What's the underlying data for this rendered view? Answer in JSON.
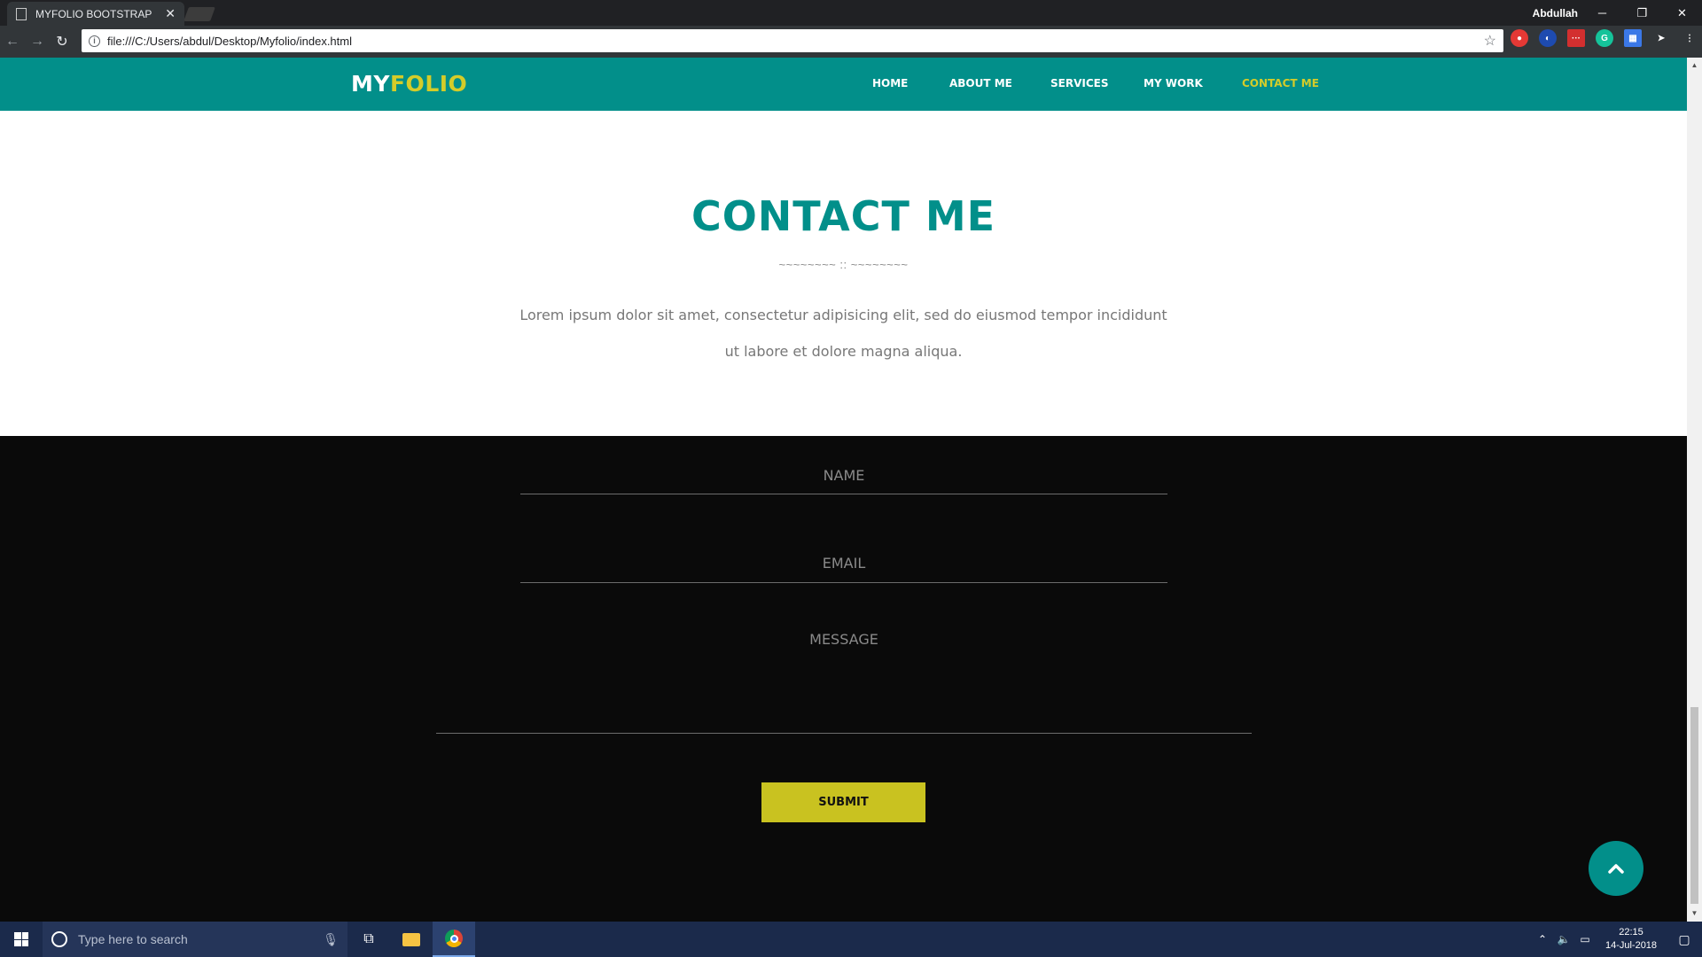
{
  "browser": {
    "tab_title": "MYFOLIO BOOTSTRAP",
    "url": "file:///C:/Users/abdul/Desktop/Myfolio/index.html",
    "user": "Abdullah"
  },
  "site": {
    "logo_part1": "MY",
    "logo_part2": "FOLIO",
    "nav": [
      {
        "label": "HOME"
      },
      {
        "label": "ABOUT ME"
      },
      {
        "label": "SERVICES"
      },
      {
        "label": "MY WORK"
      },
      {
        "label": "CONTACT ME"
      }
    ],
    "active_nav": "CONTACT ME",
    "colors": {
      "teal": "#028f8a",
      "yellow": "#d4cc29",
      "button": "#c9c220"
    }
  },
  "contact": {
    "title": "CONTACT ME",
    "divider": "~~~~~~~~ :: ~~~~~~~~",
    "lead": "Lorem ipsum dolor sit amet, consectetur adipisicing elit, sed do eiusmod tempor incididunt ut labore et dolore magna aliqua.",
    "name_placeholder": "NAME",
    "email_placeholder": "EMAIL",
    "message_placeholder": "MESSAGE",
    "submit_label": "SUBMIT"
  },
  "taskbar": {
    "search_placeholder": "Type here to search",
    "time": "22:15",
    "date": "14-Jul-2018"
  }
}
